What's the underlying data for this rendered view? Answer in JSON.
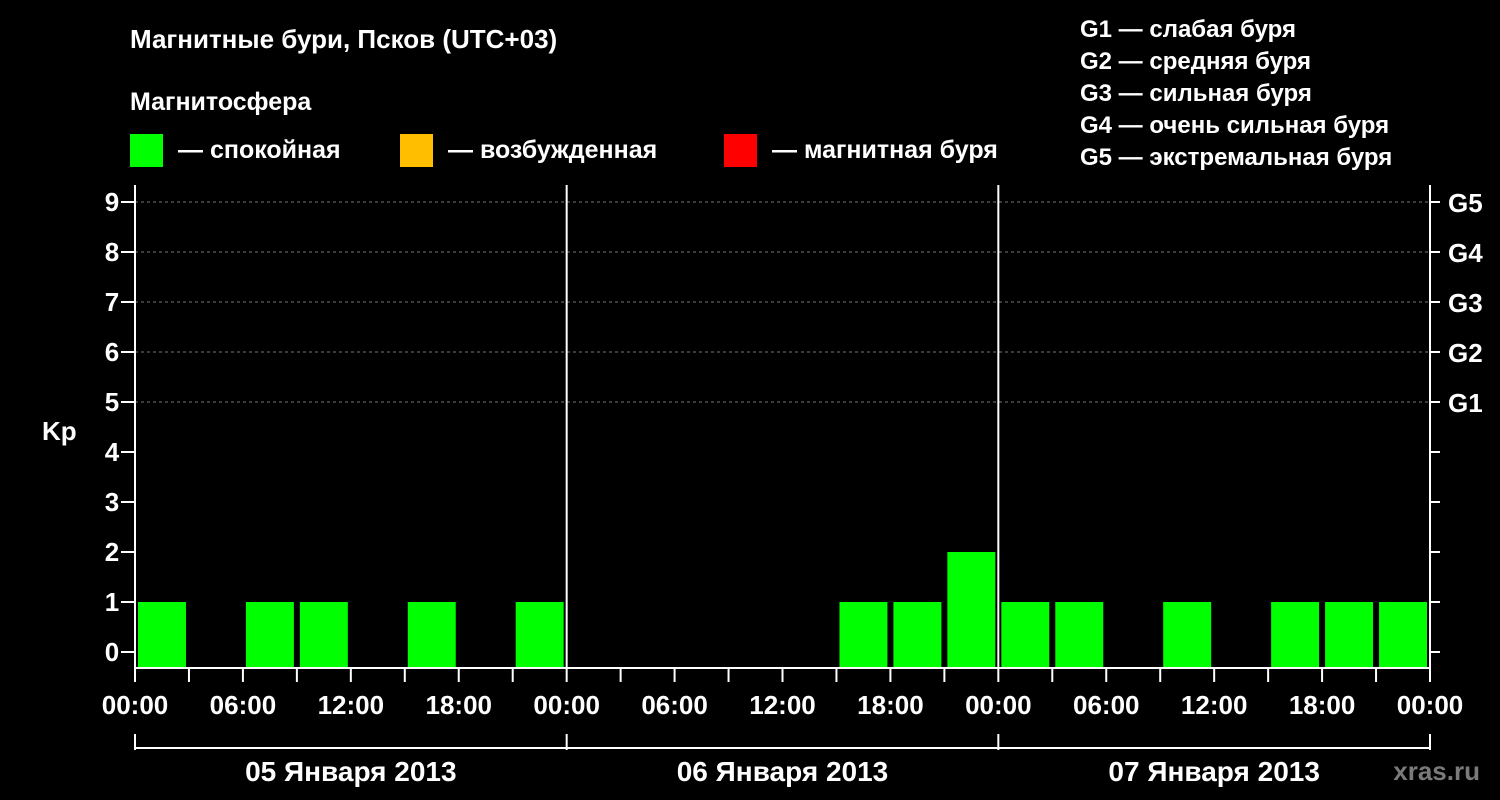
{
  "chart_data": {
    "type": "bar",
    "title": "Магнитные бури, Псков (UTC+03)",
    "legend": {
      "title": "Магнитосфера",
      "items": [
        {
          "label": "— спокойная",
          "color": "#00ff00"
        },
        {
          "label": "— возбужденная",
          "color": "#ffbf00"
        },
        {
          "label": "— магнитная буря",
          "color": "#ff0000"
        }
      ]
    },
    "storm_scale": [
      "G1 — слабая буря",
      "G2 — средняя буря",
      "G3 — сильная буря",
      "G4 — очень сильная буря",
      "G5 — экстремальная буря"
    ],
    "ylabel": "Kp",
    "ylim": [
      0,
      9
    ],
    "yticks": [
      "0",
      "1",
      "2",
      "3",
      "4",
      "5",
      "6",
      "7",
      "8",
      "9"
    ],
    "right_axis": [
      {
        "label": "G1",
        "kp": 5
      },
      {
        "label": "G2",
        "kp": 6
      },
      {
        "label": "G3",
        "kp": 7
      },
      {
        "label": "G4",
        "kp": 8
      },
      {
        "label": "G5",
        "kp": 9
      }
    ],
    "xticks": [
      "00:00",
      "06:00",
      "12:00",
      "18:00",
      "00:00",
      "06:00",
      "12:00",
      "18:00",
      "00:00",
      "06:00",
      "12:00",
      "18:00",
      "00:00"
    ],
    "days": [
      "05 Января 2013",
      "06 Января 2013",
      "07 Января 2013"
    ],
    "interval_hours": 3,
    "series": [
      {
        "values": [
          1,
          0,
          1,
          1,
          0,
          1,
          0,
          1,
          0,
          0,
          0,
          0,
          0,
          1,
          1,
          2,
          1,
          1,
          0,
          1,
          0,
          1,
          1,
          1
        ]
      }
    ],
    "grid": true
  },
  "watermark": "xras.ru"
}
